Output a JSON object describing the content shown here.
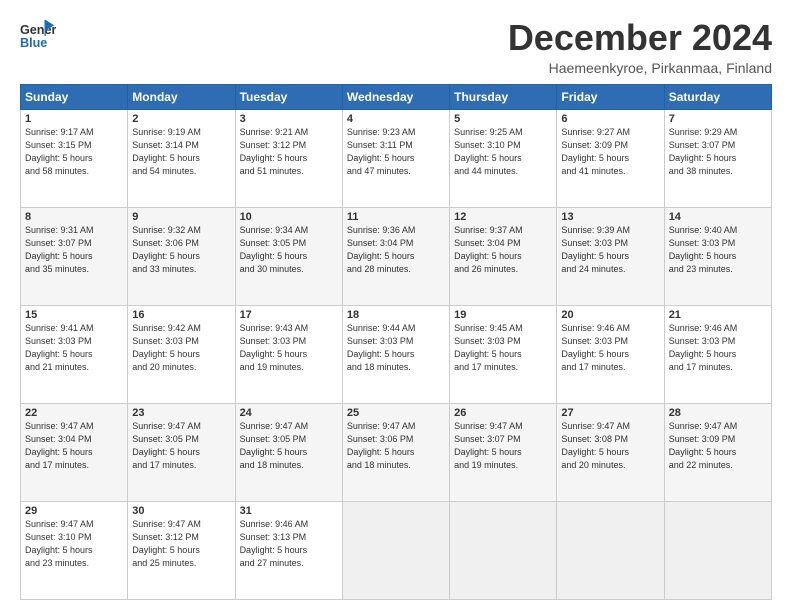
{
  "header": {
    "logo_general": "General",
    "logo_blue": "Blue",
    "title": "December 2024",
    "subtitle": "Haemeenkyroe, Pirkanmaa, Finland"
  },
  "weekdays": [
    "Sunday",
    "Monday",
    "Tuesday",
    "Wednesday",
    "Thursday",
    "Friday",
    "Saturday"
  ],
  "weeks": [
    [
      {
        "day": "1",
        "lines": [
          "Sunrise: 9:17 AM",
          "Sunset: 3:15 PM",
          "Daylight: 5 hours",
          "and 58 minutes."
        ]
      },
      {
        "day": "2",
        "lines": [
          "Sunrise: 9:19 AM",
          "Sunset: 3:14 PM",
          "Daylight: 5 hours",
          "and 54 minutes."
        ]
      },
      {
        "day": "3",
        "lines": [
          "Sunrise: 9:21 AM",
          "Sunset: 3:12 PM",
          "Daylight: 5 hours",
          "and 51 minutes."
        ]
      },
      {
        "day": "4",
        "lines": [
          "Sunrise: 9:23 AM",
          "Sunset: 3:11 PM",
          "Daylight: 5 hours",
          "and 47 minutes."
        ]
      },
      {
        "day": "5",
        "lines": [
          "Sunrise: 9:25 AM",
          "Sunset: 3:10 PM",
          "Daylight: 5 hours",
          "and 44 minutes."
        ]
      },
      {
        "day": "6",
        "lines": [
          "Sunrise: 9:27 AM",
          "Sunset: 3:09 PM",
          "Daylight: 5 hours",
          "and 41 minutes."
        ]
      },
      {
        "day": "7",
        "lines": [
          "Sunrise: 9:29 AM",
          "Sunset: 3:07 PM",
          "Daylight: 5 hours",
          "and 38 minutes."
        ]
      }
    ],
    [
      {
        "day": "8",
        "lines": [
          "Sunrise: 9:31 AM",
          "Sunset: 3:07 PM",
          "Daylight: 5 hours",
          "and 35 minutes."
        ]
      },
      {
        "day": "9",
        "lines": [
          "Sunrise: 9:32 AM",
          "Sunset: 3:06 PM",
          "Daylight: 5 hours",
          "and 33 minutes."
        ]
      },
      {
        "day": "10",
        "lines": [
          "Sunrise: 9:34 AM",
          "Sunset: 3:05 PM",
          "Daylight: 5 hours",
          "and 30 minutes."
        ]
      },
      {
        "day": "11",
        "lines": [
          "Sunrise: 9:36 AM",
          "Sunset: 3:04 PM",
          "Daylight: 5 hours",
          "and 28 minutes."
        ]
      },
      {
        "day": "12",
        "lines": [
          "Sunrise: 9:37 AM",
          "Sunset: 3:04 PM",
          "Daylight: 5 hours",
          "and 26 minutes."
        ]
      },
      {
        "day": "13",
        "lines": [
          "Sunrise: 9:39 AM",
          "Sunset: 3:03 PM",
          "Daylight: 5 hours",
          "and 24 minutes."
        ]
      },
      {
        "day": "14",
        "lines": [
          "Sunrise: 9:40 AM",
          "Sunset: 3:03 PM",
          "Daylight: 5 hours",
          "and 23 minutes."
        ]
      }
    ],
    [
      {
        "day": "15",
        "lines": [
          "Sunrise: 9:41 AM",
          "Sunset: 3:03 PM",
          "Daylight: 5 hours",
          "and 21 minutes."
        ]
      },
      {
        "day": "16",
        "lines": [
          "Sunrise: 9:42 AM",
          "Sunset: 3:03 PM",
          "Daylight: 5 hours",
          "and 20 minutes."
        ]
      },
      {
        "day": "17",
        "lines": [
          "Sunrise: 9:43 AM",
          "Sunset: 3:03 PM",
          "Daylight: 5 hours",
          "and 19 minutes."
        ]
      },
      {
        "day": "18",
        "lines": [
          "Sunrise: 9:44 AM",
          "Sunset: 3:03 PM",
          "Daylight: 5 hours",
          "and 18 minutes."
        ]
      },
      {
        "day": "19",
        "lines": [
          "Sunrise: 9:45 AM",
          "Sunset: 3:03 PM",
          "Daylight: 5 hours",
          "and 17 minutes."
        ]
      },
      {
        "day": "20",
        "lines": [
          "Sunrise: 9:46 AM",
          "Sunset: 3:03 PM",
          "Daylight: 5 hours",
          "and 17 minutes."
        ]
      },
      {
        "day": "21",
        "lines": [
          "Sunrise: 9:46 AM",
          "Sunset: 3:03 PM",
          "Daylight: 5 hours",
          "and 17 minutes."
        ]
      }
    ],
    [
      {
        "day": "22",
        "lines": [
          "Sunrise: 9:47 AM",
          "Sunset: 3:04 PM",
          "Daylight: 5 hours",
          "and 17 minutes."
        ]
      },
      {
        "day": "23",
        "lines": [
          "Sunrise: 9:47 AM",
          "Sunset: 3:05 PM",
          "Daylight: 5 hours",
          "and 17 minutes."
        ]
      },
      {
        "day": "24",
        "lines": [
          "Sunrise: 9:47 AM",
          "Sunset: 3:05 PM",
          "Daylight: 5 hours",
          "and 18 minutes."
        ]
      },
      {
        "day": "25",
        "lines": [
          "Sunrise: 9:47 AM",
          "Sunset: 3:06 PM",
          "Daylight: 5 hours",
          "and 18 minutes."
        ]
      },
      {
        "day": "26",
        "lines": [
          "Sunrise: 9:47 AM",
          "Sunset: 3:07 PM",
          "Daylight: 5 hours",
          "and 19 minutes."
        ]
      },
      {
        "day": "27",
        "lines": [
          "Sunrise: 9:47 AM",
          "Sunset: 3:08 PM",
          "Daylight: 5 hours",
          "and 20 minutes."
        ]
      },
      {
        "day": "28",
        "lines": [
          "Sunrise: 9:47 AM",
          "Sunset: 3:09 PM",
          "Daylight: 5 hours",
          "and 22 minutes."
        ]
      }
    ],
    [
      {
        "day": "29",
        "lines": [
          "Sunrise: 9:47 AM",
          "Sunset: 3:10 PM",
          "Daylight: 5 hours",
          "and 23 minutes."
        ]
      },
      {
        "day": "30",
        "lines": [
          "Sunrise: 9:47 AM",
          "Sunset: 3:12 PM",
          "Daylight: 5 hours",
          "and 25 minutes."
        ]
      },
      {
        "day": "31",
        "lines": [
          "Sunrise: 9:46 AM",
          "Sunset: 3:13 PM",
          "Daylight: 5 hours",
          "and 27 minutes."
        ]
      },
      {
        "day": "",
        "lines": []
      },
      {
        "day": "",
        "lines": []
      },
      {
        "day": "",
        "lines": []
      },
      {
        "day": "",
        "lines": []
      }
    ]
  ]
}
